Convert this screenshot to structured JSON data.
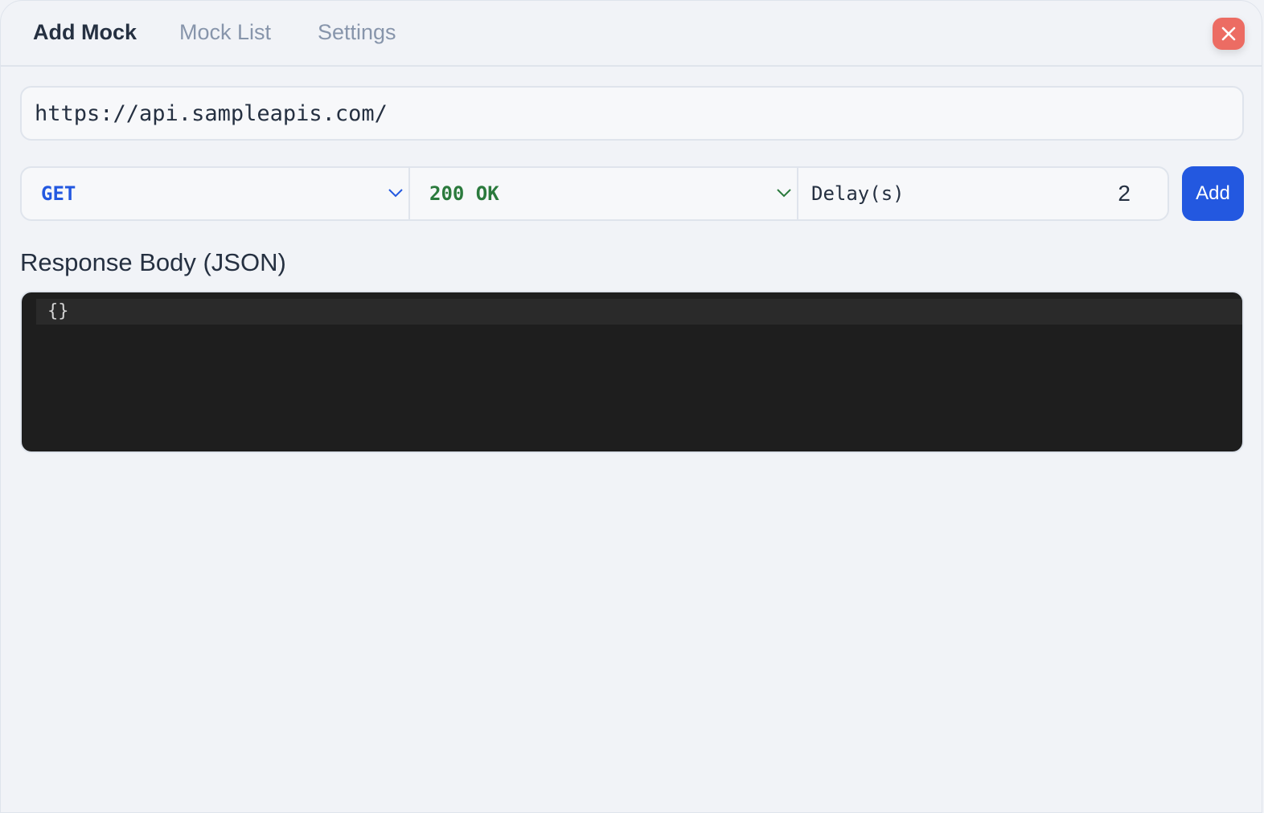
{
  "tabs": [
    {
      "label": "Add Mock",
      "active": true
    },
    {
      "label": "Mock List",
      "active": false
    },
    {
      "label": "Settings",
      "active": false
    }
  ],
  "url": {
    "value": "https://api.sampleapis.com/"
  },
  "method": {
    "value": "GET",
    "color": "#2358e0"
  },
  "status": {
    "value": "200 OK",
    "color": "#2b7a3d"
  },
  "delay": {
    "label": "Delay(s)",
    "value": "2"
  },
  "add_label": "Add",
  "response": {
    "label": "Response Body (JSON)",
    "code": "{}"
  }
}
